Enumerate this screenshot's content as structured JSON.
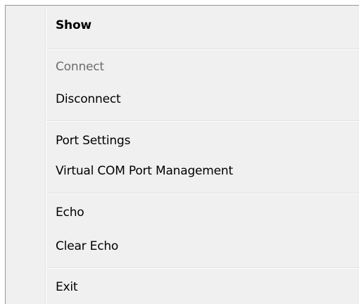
{
  "menu": {
    "show": "Show",
    "connect": "Connect",
    "disconnect": "Disconnect",
    "port_settings": "Port Settings",
    "virtual_com": "Virtual COM Port Management",
    "echo": "Echo",
    "clear_echo": "Clear Echo",
    "exit": "Exit"
  },
  "colors": {
    "background": "#f0f0f0",
    "border": "#979797",
    "disabled_text": "#6d6d6d"
  }
}
